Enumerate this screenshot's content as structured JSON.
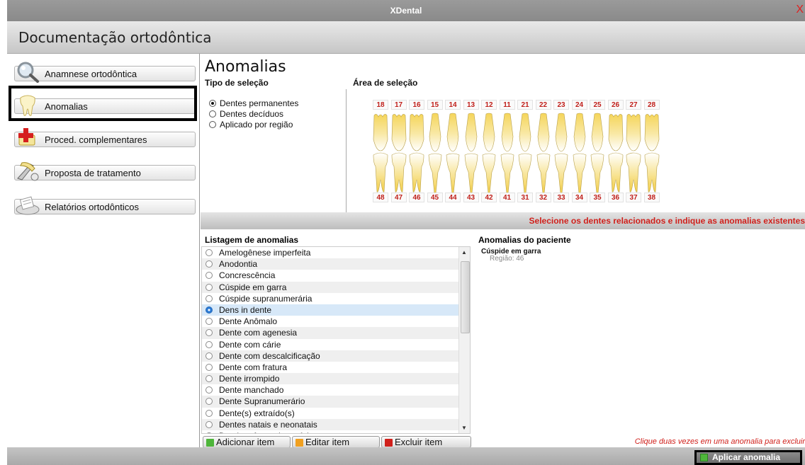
{
  "window": {
    "title": "XDental",
    "close_glyph": "X"
  },
  "header": {
    "title": "Documentação ortodôntica"
  },
  "sidebar": {
    "items": [
      {
        "label": "Anamnese ortodôntica",
        "icon": "magnifier-icon"
      },
      {
        "label": "Anomalias",
        "icon": "tooth-icon",
        "selected": true
      },
      {
        "label": "Proced. complementares",
        "icon": "medical-cross-icon"
      },
      {
        "label": "Proposta de tratamento",
        "icon": "dental-tools-icon"
      },
      {
        "label": "Relatórios ortodônticos",
        "icon": "report-tray-icon"
      }
    ]
  },
  "main": {
    "title": "Anomalias",
    "tipo_label": "Tipo de seleção",
    "area_label": "Área de seleção",
    "selection_types": [
      {
        "label": "Dentes permanentes",
        "checked": true
      },
      {
        "label": "Dentes decíduos",
        "checked": false
      },
      {
        "label": "Aplicado por região",
        "checked": false
      }
    ],
    "upper_teeth": [
      "18",
      "17",
      "16",
      "15",
      "14",
      "13",
      "12",
      "11",
      "21",
      "22",
      "23",
      "24",
      "25",
      "26",
      "27",
      "28"
    ],
    "lower_teeth": [
      "48",
      "47",
      "46",
      "45",
      "44",
      "43",
      "42",
      "41",
      "31",
      "32",
      "33",
      "34",
      "35",
      "36",
      "37",
      "38"
    ],
    "banner": "Selecione os dentes relacionados e indique as anomalias existentes",
    "list_label": "Listagem de anomalias",
    "anomalies": [
      "Amelogênese imperfeita",
      "Anodontia",
      "Concrescência",
      "Cúspide em garra",
      "Cúspide supranumerária",
      "Dens in dente",
      "Dente Anômalo",
      "Dente com agenesia",
      "Dente com cárie",
      "Dente com descalcificação",
      "Dente com fratura",
      "Dente irrompido",
      "Dente manchado",
      "Dente Supranumerário",
      "Dente(s) extraído(s)",
      "Dentes natais e neonatais",
      "Dentinogênese imperfeita"
    ],
    "selected_anomaly": "Dens in dente",
    "patient_label": "Anomalias do paciente",
    "patient_anomalies": [
      {
        "name": "Cúspide em garra",
        "region": "Região: 46"
      }
    ],
    "buttons": {
      "add": "Adicionar item",
      "edit": "Editar item",
      "delete": "Excluir item"
    },
    "hint": "Clique duas vezes em uma anomalia para excluir"
  },
  "footer": {
    "apply": "Aplicar anomalia"
  },
  "colors": {
    "accent_red": "#d0201b",
    "add_green": "#4eb53a",
    "edit_orange": "#f0a020",
    "delete_red": "#d0201b",
    "selection_blue": "#d7e8f8"
  }
}
